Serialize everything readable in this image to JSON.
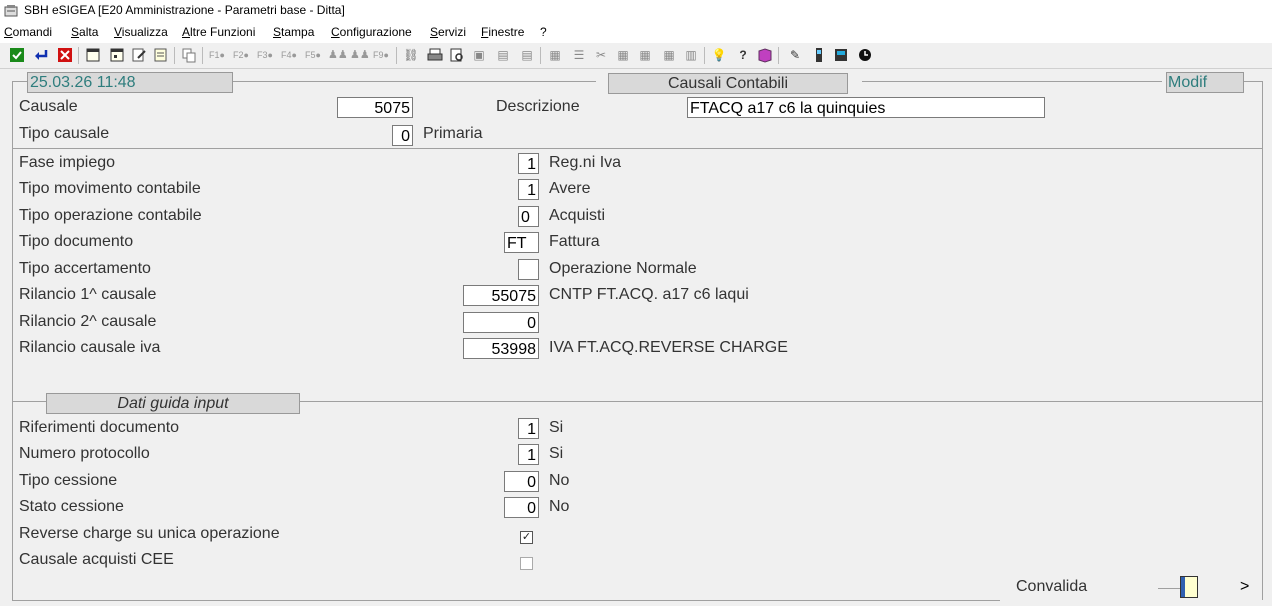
{
  "window": {
    "title": "SBH eSIGEA [E20 Amministrazione - Parametri base - Ditta]"
  },
  "menu": [
    "Comandi",
    "Salta",
    "Visualizza",
    "Altre Funzioni",
    "Stampa",
    "Configurazione",
    "Servizi",
    "Finestre",
    "?"
  ],
  "header": {
    "datetime": "25.03.26 11:48",
    "section_title": "Causali Contabili",
    "mode": "Modif"
  },
  "causale": {
    "label": "Causale",
    "value": "5075",
    "descr_label": "Descrizione",
    "descr_value": "FTACQ a17 c6 la quinquies",
    "tipo_label": "Tipo causale",
    "tipo_value": "0",
    "tipo_text": "Primaria"
  },
  "fields": [
    {
      "label": "Fase impiego",
      "value": "1",
      "text": "Reg.ni Iva"
    },
    {
      "label": "Tipo movimento contabile",
      "value": "1",
      "text": "Avere"
    },
    {
      "label": "Tipo operazione contabile",
      "value": "0",
      "text": "Acquisti"
    },
    {
      "label": "Tipo documento",
      "value": "FT",
      "text": "Fattura"
    },
    {
      "label": "Tipo accertamento",
      "value": "",
      "text": "Operazione Normale"
    },
    {
      "label": "Rilancio 1^ causale",
      "value": "55075",
      "text": "CNTP FT.ACQ. a17 c6 laqui"
    },
    {
      "label": "Rilancio 2^ causale",
      "value": "0",
      "text": ""
    },
    {
      "label": "Rilancio causale iva",
      "value": "53998",
      "text": "IVA FT.ACQ.REVERSE CHARGE"
    }
  ],
  "guida": {
    "title": "Dati guida input",
    "fields": [
      {
        "label": "Riferimenti documento",
        "value": "1",
        "text": "Si"
      },
      {
        "label": "Numero protocollo",
        "value": "1",
        "text": "Si"
      },
      {
        "label": "Tipo cessione",
        "value": "0",
        "text": "No"
      },
      {
        "label": "Stato cessione",
        "value": "0",
        "text": "No"
      }
    ],
    "checks": [
      {
        "label": "Reverse charge su unica operazione",
        "checked": true,
        "mark": "✓"
      },
      {
        "label": "Causale acquisti CEE",
        "checked": false,
        "mark": ""
      }
    ]
  },
  "footer": {
    "convalida": "Convalida",
    "next": ">"
  },
  "colors": {
    "header_text": "#2e7d7d",
    "field_border": "#7a7a7a",
    "accent_ok": "#1a8a1a",
    "accent_cancel": "#d01010"
  },
  "icons": [
    "ok-icon",
    "enter-icon",
    "cancel-icon",
    "calendar-icon",
    "calendar2-icon",
    "edit-icon",
    "note-icon",
    "copy-icon",
    "f1-icon",
    "f2-icon",
    "f3-icon",
    "f4-icon",
    "f5-icon",
    "users-icon",
    "f9-icon",
    "link-icon",
    "print-icon",
    "preview-icon",
    "image-icon",
    "print2-icon",
    "print3-icon",
    "grid-icon",
    "list-icon",
    "tools-icon",
    "grid2-icon",
    "grid3-icon",
    "grid4-icon",
    "chart-icon",
    "bulb-icon",
    "help-icon",
    "book-icon",
    "write-icon",
    "phone-icon",
    "calc-icon",
    "clock-icon"
  ]
}
